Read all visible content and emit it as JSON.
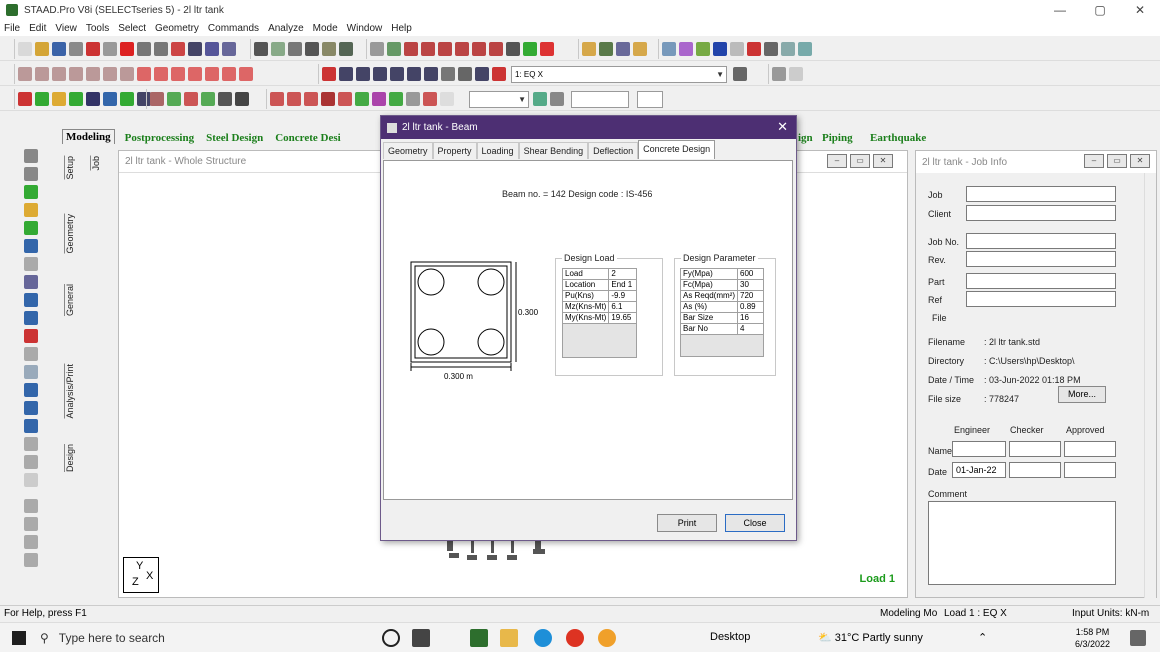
{
  "window": {
    "title": "STAAD.Pro V8i (SELECTseries 5) - 2l ltr tank",
    "min": "—",
    "max": "▢",
    "close": "✕"
  },
  "menu": [
    "File",
    "Edit",
    "View",
    "Tools",
    "Select",
    "Geometry",
    "Commands",
    "Analyze",
    "Mode",
    "Window",
    "Help"
  ],
  "toolbar": {
    "load_combo": "1: EQ X"
  },
  "page_tabs": [
    "Modeling",
    "Postprocessing",
    "Steel Design",
    "Concrete Desi",
    "ign",
    "Piping",
    "Earthquake"
  ],
  "side_tabs": [
    "Setup",
    "Geometry",
    "General",
    "Analysis/Print",
    "Design"
  ],
  "side_tabs2": [
    "Job"
  ],
  "structure_window": {
    "title": "2l ltr tank - Whole Structure",
    "load_label": "Load 1",
    "axis_y": "Y",
    "axis_z": "Z",
    "axis_x": "X"
  },
  "job_info": {
    "title": "2l ltr tank - Job Info",
    "fields": [
      "Job",
      "Client",
      "Job No.",
      "Rev.",
      "Part",
      "Ref"
    ],
    "file_section": "File",
    "filename_label": "Filename",
    "filename": ": 2l ltr tank.std",
    "directory_label": "Directory",
    "directory": ": C:\\Users\\hp\\Desktop\\",
    "datetime_label": "Date / Time",
    "datetime": ": 03-Jun-2022   01:18 PM",
    "filesize_label": "File size",
    "filesize": ": 778247",
    "more_button": "More...",
    "col_engineer": "Engineer",
    "col_checker": "Checker",
    "col_approved": "Approved",
    "name_label": "Name",
    "date_label": "Date",
    "date_value": "01-Jan-22",
    "comment_label": "Comment"
  },
  "dialog": {
    "title": "2l ltr tank - Beam",
    "close": "✕",
    "tabs": [
      "Geometry",
      "Property",
      "Loading",
      "Shear Bending",
      "Deflection",
      "Concrete Design"
    ],
    "active_tab": "Concrete Design",
    "beam_info": "Beam no. = 142   Design code :  IS-456",
    "section": {
      "depth": "0.300",
      "width": "0.300 m"
    },
    "design_load": {
      "legend": "Design Load",
      "rows": [
        [
          "Load",
          "2"
        ],
        [
          "Location",
          "End 1"
        ],
        [
          "Pu(Kns)",
          "-9.9"
        ],
        [
          "Mz(Kns-Mt)",
          "6.1"
        ],
        [
          "My(Kns-Mt)",
          "19.65"
        ]
      ]
    },
    "design_parameter": {
      "legend": "Design Parameter",
      "rows": [
        [
          "Fy(Mpa)",
          "600"
        ],
        [
          "Fc(Mpa)",
          "30"
        ],
        [
          "As Reqd(mm²)",
          "720"
        ],
        [
          "As (%)",
          "0.89"
        ],
        [
          "Bar Size",
          "16"
        ],
        [
          "Bar No",
          "4"
        ]
      ]
    },
    "print_button": "Print",
    "close_button": "Close"
  },
  "status": {
    "help": "For Help, press F1",
    "mode": "Modeling Mo",
    "load": "Load 1 : EQ X",
    "units": "Input Units:  kN-m"
  },
  "taskbar": {
    "search_placeholder": "Type here to search",
    "desktop": "Desktop",
    "weather": "31°C  Partly sunny",
    "time": "1:58 PM",
    "date": "6/3/2022"
  }
}
